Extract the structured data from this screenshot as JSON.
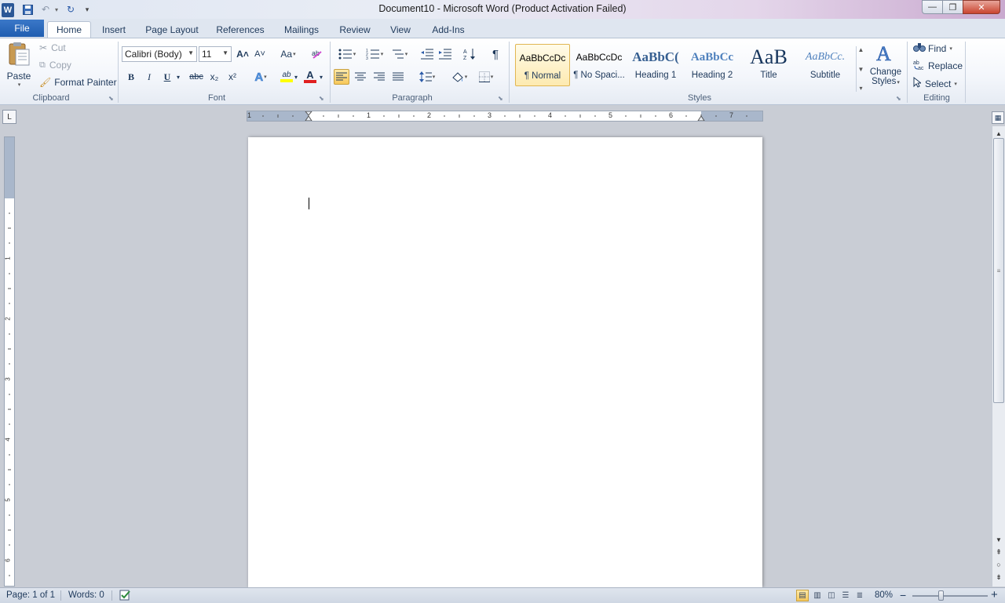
{
  "window": {
    "title": "Document10  -  Microsoft Word (Product Activation Failed)",
    "app_icon": "W",
    "app_icon_name": "word-icon",
    "controls": {
      "minimize": "—",
      "maximize": "❐",
      "close": "✕"
    }
  },
  "quick_access": {
    "save": "💾",
    "undo": "↶",
    "redo": "↻",
    "customize": "▾"
  },
  "tabs": {
    "file": "File",
    "items": [
      {
        "label": "Home",
        "active": true
      },
      {
        "label": "Insert"
      },
      {
        "label": "Page Layout"
      },
      {
        "label": "References"
      },
      {
        "label": "Mailings"
      },
      {
        "label": "Review"
      },
      {
        "label": "View"
      },
      {
        "label": "Add-Ins"
      }
    ],
    "minimize_ribbon": "∧",
    "help": "?"
  },
  "clipboard": {
    "paste": "Paste",
    "cut": "Cut",
    "copy": "Copy",
    "format_painter": "Format Painter",
    "group_label": "Clipboard"
  },
  "font": {
    "font_name": "Calibri (Body)",
    "font_size": "11",
    "grow": "A˄",
    "shrink": "A˅",
    "change_case": "Aa",
    "clear_format": "ℂ",
    "bold": "B",
    "italic": "I",
    "underline": "U",
    "strike": "abc",
    "subscript": "x₂",
    "superscript": "x²",
    "text_effects": "A",
    "highlight": "ab",
    "font_color": "A",
    "group_label": "Font"
  },
  "paragraph": {
    "bullets": "•≡",
    "numbering": "1≡",
    "multilevel": "≡",
    "decrease_indent": "⇤",
    "increase_indent": "⇥",
    "sort": "A↓",
    "show_marks": "¶",
    "align_left": "≡",
    "center": "≡",
    "align_right": "≡",
    "justify": "≡",
    "line_spacing": "↕≡",
    "shading": "◇",
    "borders": "⊞",
    "group_label": "Paragraph"
  },
  "styles": {
    "items": [
      {
        "sample": "AaBbCcDc",
        "name": "¶ Normal",
        "selected": true
      },
      {
        "sample": "AaBbCcDc",
        "name": "¶ No Spaci..."
      },
      {
        "sample": "AaBbC(",
        "name": "Heading 1"
      },
      {
        "sample": "AaBbCc",
        "name": "Heading 2"
      },
      {
        "sample": "AaB",
        "name": "Title"
      },
      {
        "sample": "AaBbCc.",
        "name": "Subtitle"
      }
    ],
    "change_styles_line1": "Change",
    "change_styles_line2": "Styles",
    "group_label": "Styles"
  },
  "editing": {
    "find": "Find",
    "replace": "Replace",
    "select": "Select",
    "group_label": "Editing"
  },
  "ruler": {
    "h_numbers": [
      "1",
      "1",
      "2",
      "3",
      "4",
      "5",
      "6",
      "7"
    ],
    "v_numbers": [
      "1",
      "2",
      "3",
      "4",
      "5",
      "6"
    ],
    "tab_selector": "L"
  },
  "status": {
    "page": "Page: 1 of 1",
    "words": "Words: 0",
    "zoom": "80%",
    "zoom_level": 0.8,
    "zoom_out": "−",
    "zoom_in": "+"
  },
  "colors": {
    "file_tab": "#2b6cc4",
    "selected_highlight": "#f7c85a",
    "font_color_bar": "#e02020",
    "highlight_bar": "#ffff00"
  }
}
